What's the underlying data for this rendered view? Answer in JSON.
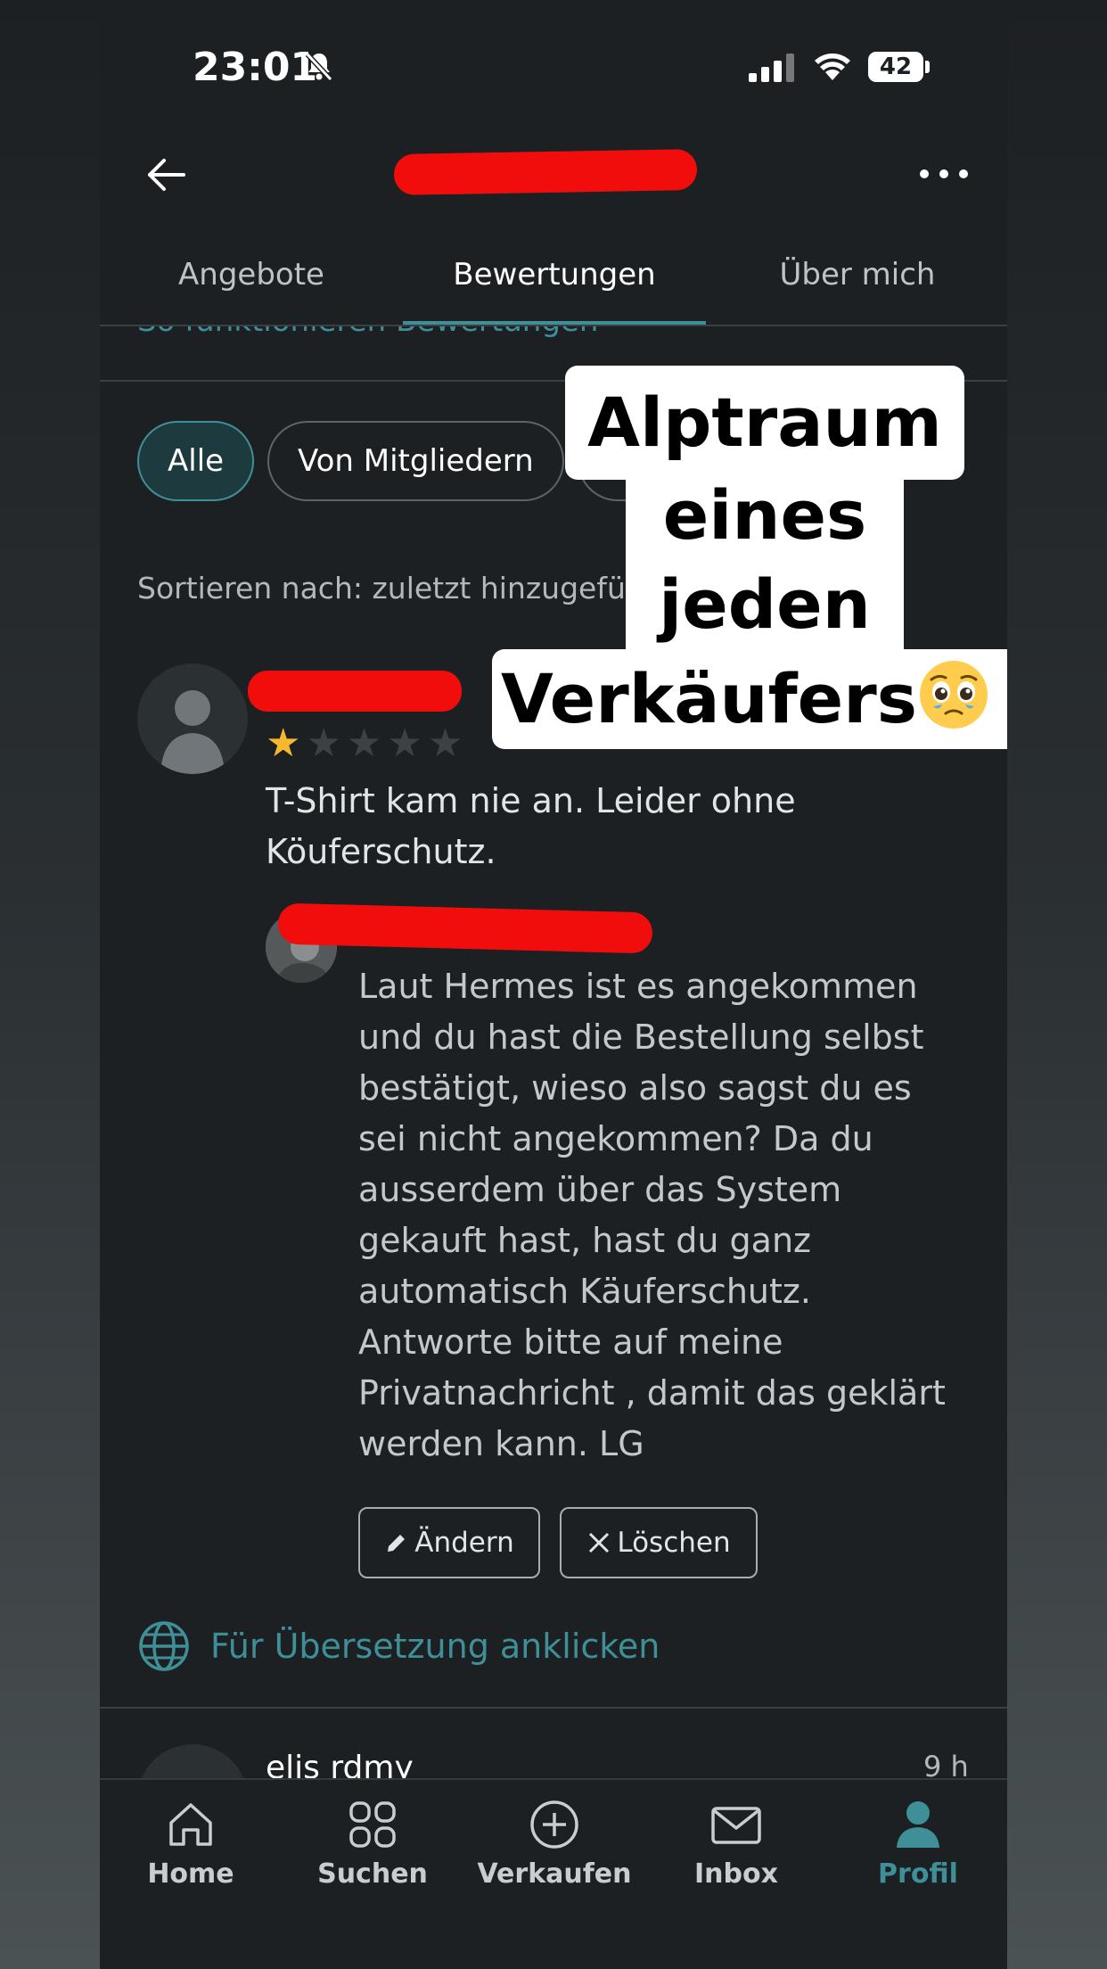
{
  "status_bar": {
    "time": "23:01",
    "battery": "42"
  },
  "tabs": [
    {
      "label": "Angebote"
    },
    {
      "label": "Bewertungen"
    },
    {
      "label": "Über mich"
    }
  ],
  "howto_link": "So funktionieren Bewertungen",
  "filters": [
    {
      "label": "Alle"
    },
    {
      "label": "Von Mitgliedern"
    }
  ],
  "sort_label": "Sortieren nach: zuletzt hinzugefü",
  "review": {
    "rating": 1,
    "max_rating": 5,
    "text_line1": "T-Shirt kam nie an. Leider ohne",
    "text_line2": "Köuferschutz.",
    "reply_lines": [
      "Laut Hermes ist es angekommen",
      "und du hast die Bestellung selbst",
      "bestätigt, wieso also sagst du es",
      "sei nicht angekommen? Da du",
      "ausserdem über das System",
      "gekauft hast, hast du ganz",
      "automatisch Käuferschutz.",
      "Antworte bitte auf meine",
      "Privatnachricht , damit das geklärt",
      "werden kann. LG"
    ],
    "edit_label": "Ändern",
    "delete_label": "Löschen",
    "translate_label": "Für Übersetzung anklicken"
  },
  "next_review": {
    "name": "elis rdmy",
    "time": "9 h"
  },
  "bottom_nav": [
    {
      "label": "Home",
      "icon": "home-icon"
    },
    {
      "label": "Suchen",
      "icon": "grid-icon"
    },
    {
      "label": "Verkaufen",
      "icon": "plus-circle-icon"
    },
    {
      "label": "Inbox",
      "icon": "mail-icon"
    },
    {
      "label": "Profil",
      "icon": "person-icon"
    }
  ],
  "overlay": {
    "line1": "Alptraum",
    "line2": "eines",
    "line3": "jeden",
    "line4": "Verkäufers",
    "emoji": "pleading-face-emoji"
  },
  "colors": {
    "accent": "#3f8f99",
    "background": "#1d2022",
    "star": "#f5b92e",
    "redaction": "#f20d0d"
  }
}
